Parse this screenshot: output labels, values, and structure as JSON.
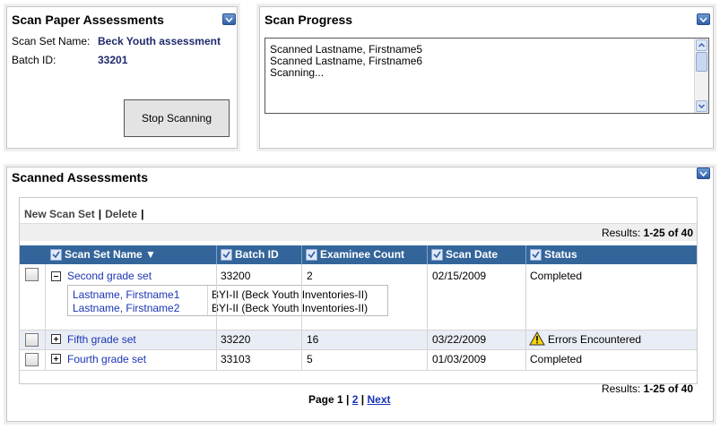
{
  "scan_paper": {
    "title": "Scan Paper Assessments",
    "set_name_label": "Scan Set Name:",
    "set_name_value": "Beck Youth assessment",
    "batch_label": "Batch ID:",
    "batch_value": "33201",
    "stop_label": "Stop Scanning"
  },
  "scan_progress": {
    "title": "Scan Progress",
    "lines": [
      "Scanned Lastname, Firstname5",
      "Scanned Lastname, Firstname6",
      "Scanning..."
    ]
  },
  "scanned": {
    "title": "Scanned Assessments",
    "toolbar": {
      "new_label": "New Scan Set",
      "delete_label": "Delete",
      "sep": "|"
    },
    "results_prefix": "Results:",
    "results_range": "1-25 of 40",
    "columns": [
      "Scan Set Name ▼",
      "Batch ID",
      "Examinee Count",
      "Scan Date",
      "Status"
    ],
    "rows": [
      {
        "name": "Second grade set",
        "batch": "33200",
        "count": "2",
        "date": "02/15/2009",
        "status": "Completed"
      },
      {
        "name": "Fifth grade set",
        "batch": "33220",
        "count": "16",
        "date": "03/22/2009",
        "status": "Errors Encountered"
      },
      {
        "name": "Fourth grade set",
        "batch": "33103",
        "count": "5",
        "date": "01/03/2009",
        "status": "Completed"
      }
    ],
    "sub_rows": [
      {
        "name": "Lastname, Firstname1",
        "test": "BYI-II (Beck Youth Inventories-II)"
      },
      {
        "name": "Lastname, Firstname2",
        "test": "BYI-II (Beck Youth Inventories-II)"
      }
    ],
    "pager": {
      "label": "Page 1",
      "sep": "|",
      "p2": "2",
      "next": "Next"
    }
  },
  "colors": {
    "header": "#34659a",
    "link": "#1a34b3",
    "alt_row": "#e9edf5"
  }
}
